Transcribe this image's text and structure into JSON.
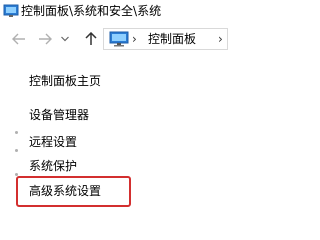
{
  "window": {
    "title": "控制面板\\系统和安全\\系统"
  },
  "colors": {
    "highlight": "#d32f2f",
    "nav_arrow": "#b0b0b0",
    "up_arrow": "#333333"
  },
  "navbar": {
    "back_icon": "arrow-left-icon",
    "forward_icon": "arrow-right-icon",
    "recent_icon": "chevron-down-icon",
    "up_icon": "arrow-up-icon",
    "address": {
      "location_icon": "monitor-icon",
      "separator": "›",
      "current": "控制面板",
      "trailing_separator": "›"
    }
  },
  "sidebar": {
    "home": "控制面板主页",
    "items": [
      {
        "label": "设备管理器"
      },
      {
        "label": "远程设置"
      },
      {
        "label": "系统保护"
      },
      {
        "label": "高级系统设置",
        "highlighted": true
      }
    ]
  }
}
